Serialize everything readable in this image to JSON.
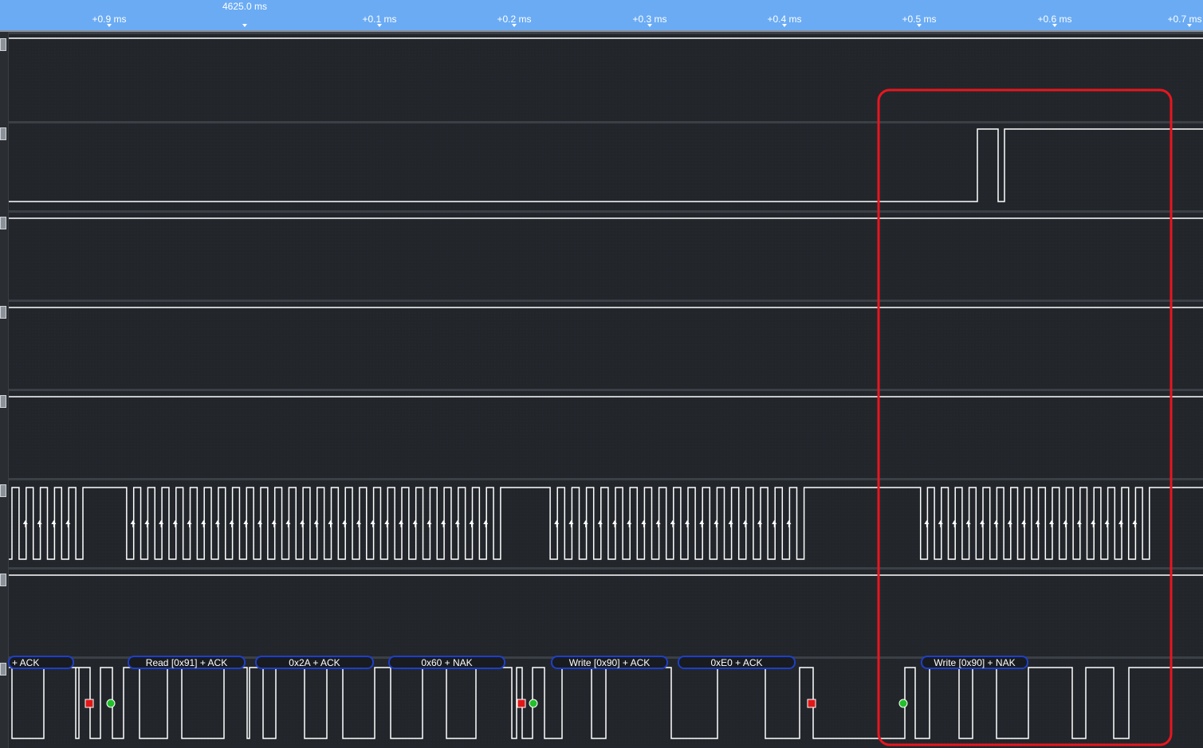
{
  "ruler": {
    "reference_label": "4625.0 ms",
    "ticks": [
      "+0.9 ms",
      "+0.1 ms",
      "+0.2 ms",
      "+0.3 ms",
      "+0.4 ms",
      "+0.5 ms",
      "+0.6 ms",
      "+0.7 ms"
    ]
  },
  "decoder": {
    "frames": [
      {
        "label": "+ ACK",
        "type": "data"
      },
      {
        "label": "Read [0x91] + ACK",
        "type": "address"
      },
      {
        "label": "0x2A + ACK",
        "type": "data"
      },
      {
        "label": "0x60 + NAK",
        "type": "data"
      },
      {
        "label": "Write [0x90] + ACK",
        "type": "address"
      },
      {
        "label": "0xE0 + ACK",
        "type": "data"
      },
      {
        "label": "Write [0x90] + NAK",
        "type": "address"
      }
    ],
    "markers": [
      {
        "kind": "stop",
        "color": "#e01818"
      },
      {
        "kind": "start",
        "color": "#22c02a"
      },
      {
        "kind": "stop",
        "color": "#e01818"
      },
      {
        "kind": "start",
        "color": "#22c02a"
      },
      {
        "kind": "stop",
        "color": "#e01818"
      },
      {
        "kind": "start",
        "color": "#22c02a"
      }
    ]
  },
  "highlight": {
    "color": "#e8161e"
  },
  "colors": {
    "ruler": "#6aabf4",
    "background": "#1b1e22",
    "trace": "#ffffff",
    "bubble": "#1e3fc8"
  }
}
